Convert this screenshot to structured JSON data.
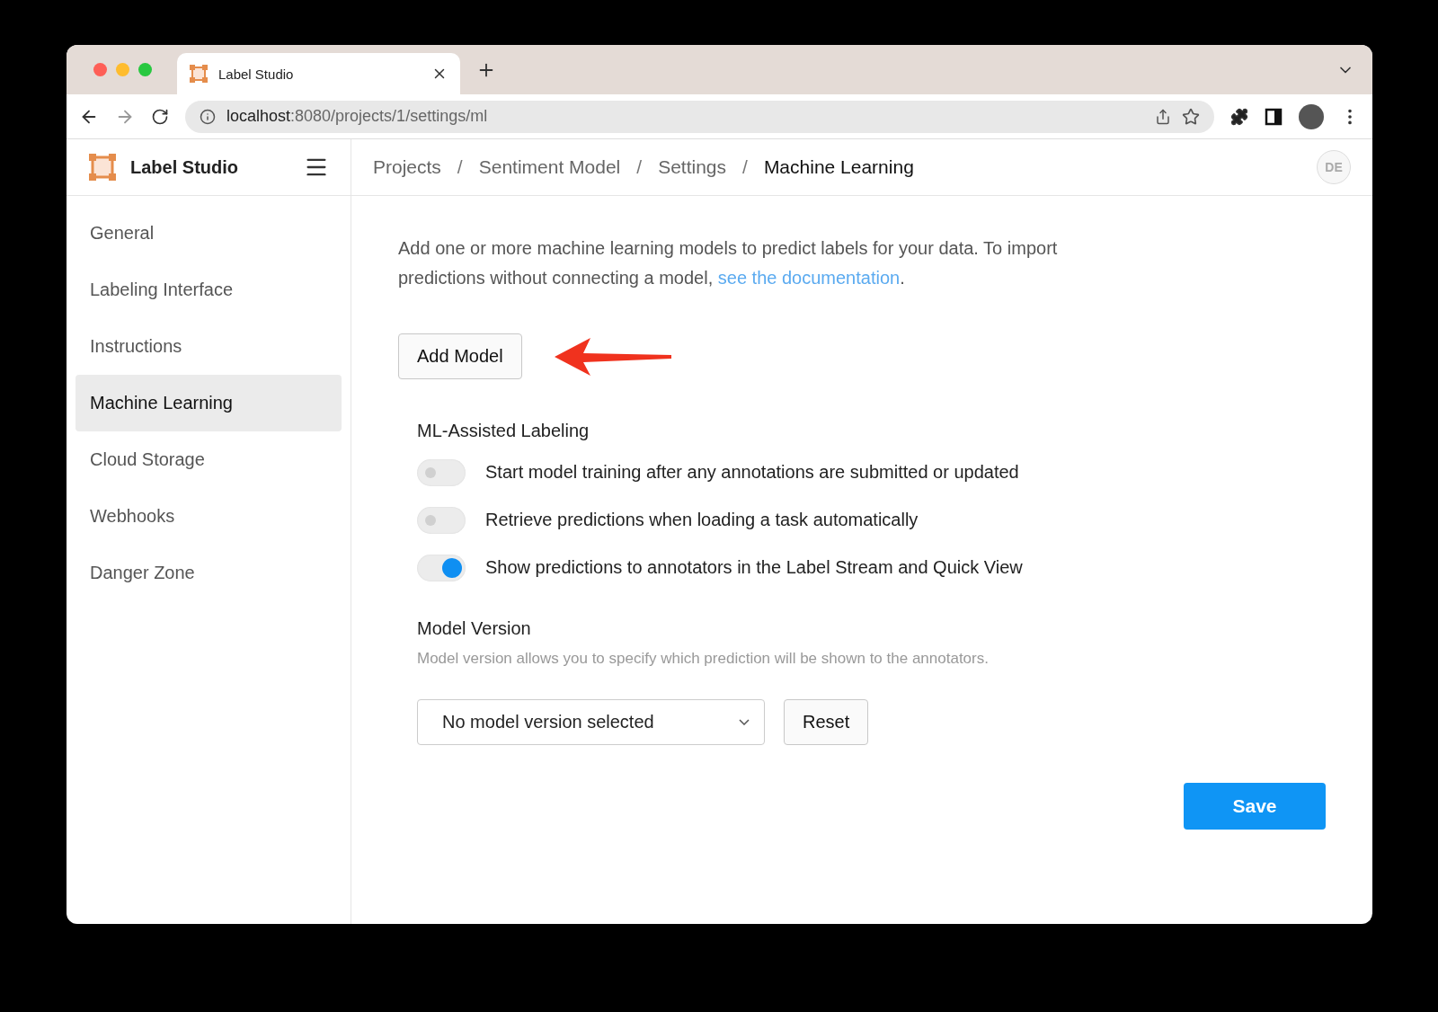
{
  "browser": {
    "tab_title": "Label Studio",
    "url": {
      "host": "localhost",
      "path": ":8080/projects/1/settings/ml"
    }
  },
  "app": {
    "name": "Label Studio",
    "user_initials": "DE"
  },
  "breadcrumbs": [
    {
      "label": "Projects",
      "current": false
    },
    {
      "label": "Sentiment Model",
      "current": false
    },
    {
      "label": "Settings",
      "current": false
    },
    {
      "label": "Machine Learning",
      "current": true
    }
  ],
  "breadcrumb_separator": "/",
  "sidebar": {
    "items": [
      {
        "label": "General",
        "selected": false
      },
      {
        "label": "Labeling Interface",
        "selected": false
      },
      {
        "label": "Instructions",
        "selected": false
      },
      {
        "label": "Machine Learning",
        "selected": true
      },
      {
        "label": "Cloud Storage",
        "selected": false
      },
      {
        "label": "Webhooks",
        "selected": false
      },
      {
        "label": "Danger Zone",
        "selected": false
      }
    ]
  },
  "intro": {
    "text": "Add one or more machine learning models to predict labels for your data. To import predictions without connecting a model, ",
    "link": "see the documentation",
    "end": "."
  },
  "add_model_button": "Add Model",
  "ml_assisted": {
    "title": "ML-Assisted Labeling",
    "toggles": [
      {
        "label": "Start model training after any annotations are submitted or updated",
        "on": false
      },
      {
        "label": "Retrieve predictions when loading a task automatically",
        "on": false
      },
      {
        "label": "Show predictions to annotators in the Label Stream and Quick View",
        "on": true
      }
    ]
  },
  "model_version": {
    "title": "Model Version",
    "description": "Model version allows you to specify which prediction will be shown to the annotators.",
    "select_value": "No model version selected",
    "reset_button": "Reset"
  },
  "save_button": "Save"
}
